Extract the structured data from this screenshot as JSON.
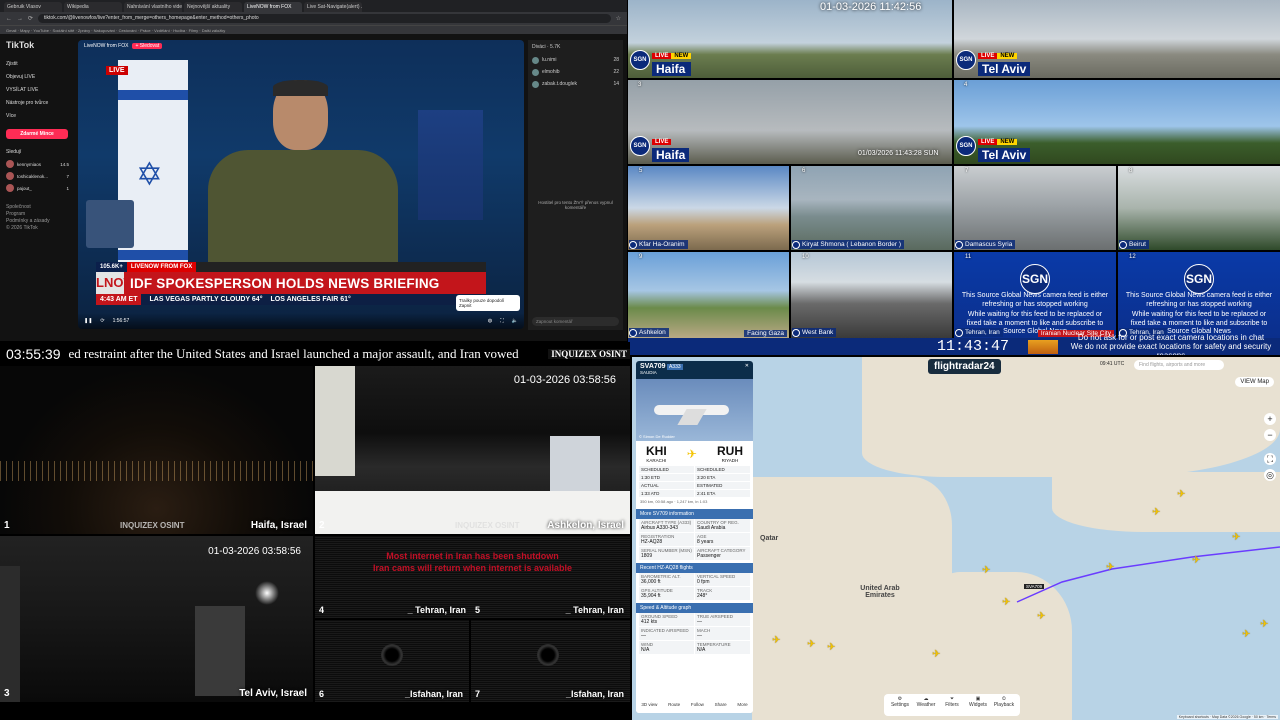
{
  "browser": {
    "tabs": [
      "Gebruik Vlasov",
      "Wikipedia",
      "Nahrávání vlastního videa",
      "Nejnovější aktuality",
      "LiveNOW from FOX",
      "Live Sat-Navigate(alert) ..."
    ],
    "url": "tiktok.com/@livenowfox/live?enter_from_merge=others_homepage&enter_method=others_photo",
    "bookmarks": "Gmail · Mapy · YouTube · Sociální sítě · Zprávy · Nakupování · Cestování · Práce · Vzdělání · Hudba · Filmy · Další záložky"
  },
  "tiktok": {
    "logo": "TikTok",
    "nav": [
      "Zjistit",
      "Objevuj LIVE",
      "VYSÍLAT LIVE",
      "Nástroje pro tvůrce",
      "Více"
    ],
    "go_live_btn": "Zdarmé Mince",
    "following_header": "Sledují",
    "accounts": [
      {
        "name": "kennymiaos",
        "sub": "Kenny Miaos",
        "count": "14.5"
      },
      {
        "name": "toshicaklenok...",
        "sub": "Kristýna",
        "count": "7"
      },
      {
        "name": "pajout_",
        "sub": "Pajout",
        "count": "1"
      }
    ],
    "footer": [
      "Společnost",
      "Program",
      "Podmínky a zásady",
      "© 2026 TikTok"
    ],
    "stream": {
      "channel": "LiveNOW from FOX",
      "follow": "+ Sledovat",
      "live_badge": "LIVE",
      "viewers": "105.6K+",
      "tag1": "LIVENOW FROM FOX",
      "logo": "LNOW",
      "headline": "IDF SPOKESPERSON HOLDS NEWS BRIEFING",
      "time": "4:43 AM ET",
      "weather": [
        "LAS VEGAS  PARTLY CLOUDY 64°",
        "LOS ANGELES  FAIR 61°"
      ],
      "tooltip": "Trailky pouze dopodolí Zapnit",
      "elapsed": "1:56:57"
    },
    "chat": {
      "title": "Diváci · 5.7K",
      "users": [
        {
          "name": "lu.nimi",
          "n": "28"
        },
        {
          "name": "elmohib",
          "n": "22"
        },
        {
          "name": "zabak.t.douglek",
          "n": "14"
        }
      ],
      "message": "Hostitel pro tento ŽIVÝ přenos vypnul komentáře",
      "input": "Zapnout komentář"
    }
  },
  "sgn": {
    "top_timestamp": "01-03-2026 11:42:56",
    "cams": [
      {
        "num": "1",
        "city": "Haifa",
        "live": "LIVE",
        "new": "NEW"
      },
      {
        "num": "2",
        "city": "Tel Aviv",
        "live": "LIVE",
        "new": "NEW"
      },
      {
        "num": "3",
        "city": "Haifa",
        "live": "LIVE",
        "new": ""
      },
      {
        "num": "4",
        "city": "Tel Aviv",
        "live": "LIVE",
        "new": "NEW"
      }
    ],
    "cam3_timestamp": "01/03/2026 11:43:28 SUN",
    "small_cams": [
      {
        "num": "5",
        "label": "Kfar Ha-Oranim"
      },
      {
        "num": "6",
        "label": "Kiryat Shmona ( Lebanon Border )"
      },
      {
        "num": "7",
        "label": "Damascus Syria"
      },
      {
        "num": "8",
        "label": "Beirut"
      },
      {
        "num": "9",
        "label": "Ashkelon",
        "extra": "Facing Gaza"
      },
      {
        "num": "10",
        "label": "West Bank"
      },
      {
        "num": "11",
        "label": "Tehran, Iran",
        "extra": "Iranian Nuclear Site City"
      },
      {
        "num": "12",
        "label": "Tehran, Iran"
      }
    ],
    "offline_logo": "SGN",
    "offline_text": "This Source Global News camera feed is either refreshing or has stopped working",
    "offline_text2": "While waiting for this feed to be replaced or fixed take a moment to like and subscribe to Source Global News",
    "clock": "11:43:47",
    "notice": [
      "Do not ask for or post exact camera locations in chat",
      "We do not provide exact locations for safety and security reasons"
    ]
  },
  "osint": {
    "clock": "03:55:39",
    "ticker": "ed restraint after the United States and Israel launched a major assault, and Iran vowed",
    "brand": "INQUIZEX OSINT",
    "cams": [
      {
        "num": "1",
        "label": "Haifa, Israel"
      },
      {
        "num": "2",
        "label": "Ashkelon, Israel",
        "ts": "01-03-2026 03:58:56"
      },
      {
        "num": "3",
        "label": "Tel Aviv, Israel",
        "ts": "01-03-2026 03:58:56"
      },
      {
        "num": "4",
        "label": "_ Tehran, Iran"
      },
      {
        "num": "5",
        "label": "_ Tehran, Iran"
      },
      {
        "num": "6",
        "label": "_Isfahan, Iran"
      },
      {
        "num": "7",
        "label": "_Isfahan, Iran"
      }
    ],
    "red_msg1": "Most internet in Iran has been shutdown",
    "red_msg2": "Iran cams will return when internet is available"
  },
  "fr24": {
    "logo": "flightradar24",
    "clock": "09:41 UTC",
    "search_placeholder": "Find flights, airports and more",
    "view_btn": "VIEW  Map",
    "flight": "SVA709",
    "flight_badge": "A333",
    "airline": "SAUDIA",
    "photo_credit": "© Simon De Rudder",
    "from": {
      "code": "KHI",
      "city": "KARACHI"
    },
    "to": {
      "code": "RUH",
      "city": "RIYADH"
    },
    "times": [
      [
        "SCHEDULED",
        "1:30 ETD",
        "SCHEDULED",
        "3:20 ETA"
      ],
      [
        "ACTUAL",
        "1:33 ATD",
        "ESTIMATED",
        "2:41 ETA"
      ]
    ],
    "progress": "350 km, 00:58 ago · 1,247 km, in 1:03",
    "sections": [
      {
        "title": "More SV709 information",
        "kv": [
          [
            "AIRCRAFT TYPE (A333)",
            "Airbus A330-343"
          ],
          [
            "REGISTRATION",
            "HZ-AQ28"
          ],
          [
            "COUNTRY OF REG.",
            "Saudi Arabia"
          ],
          [
            "SERIAL NUMBER (MSN)",
            "1809"
          ],
          [
            "AGE",
            "8 years"
          ],
          [
            "AIRCRAFT CATEGORY",
            "Passenger"
          ]
        ]
      },
      {
        "title": "Recent HZ-AQ28 flights",
        "kv": [
          [
            "BAROMETRIC ALT.",
            "36,000 ft"
          ],
          [
            "VERTICAL SPEED",
            "0 fpm"
          ],
          [
            "GPS ALTITUDE",
            "35,904 ft"
          ],
          [
            "TRACK",
            "248°"
          ]
        ]
      },
      {
        "title": "Speed & Altitude graph",
        "kv": [
          [
            "GROUND SPEED",
            "412 kts"
          ],
          [
            "TRUE AIRSPEED",
            "—"
          ],
          [
            "INDICATED AIRSPEED",
            "—"
          ],
          [
            "MACH",
            "—"
          ],
          [
            "WIND",
            "N/A"
          ],
          [
            "TEMPERATURE",
            "N/A"
          ]
        ]
      }
    ],
    "panel_toolbar": [
      "3D view",
      "Route",
      "Follow",
      "Share",
      "More"
    ],
    "map_labels": [
      "Qatar",
      "United Arab Emirates",
      "SVA709"
    ],
    "bottom_ctl": [
      "Settings",
      "Weather",
      "Filters",
      "Widgets",
      "Playback"
    ],
    "attribution": "Keyboard shortcuts · Map Data ©2026 Google · 50 km · Terms"
  }
}
